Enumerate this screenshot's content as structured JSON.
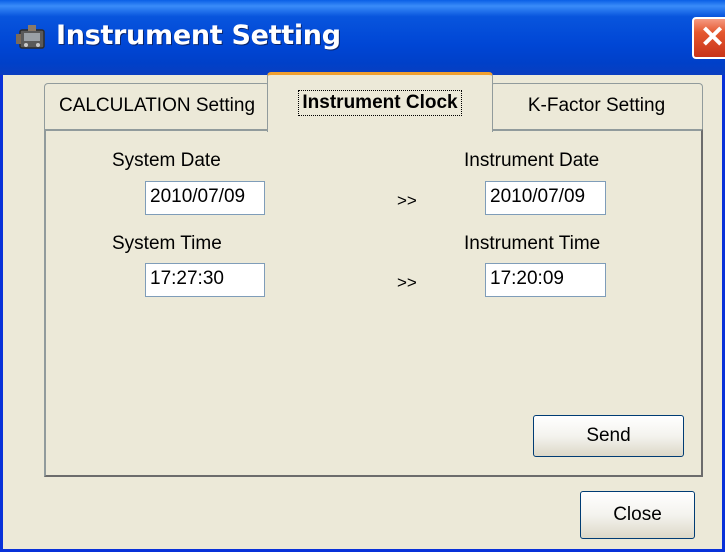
{
  "window": {
    "title": "Instrument Setting",
    "close_glyph": "✕"
  },
  "tabs": [
    {
      "label": "CALCULATION Setting",
      "active": false
    },
    {
      "label": "Instrument Clock",
      "active": true
    },
    {
      "label": "K-Factor Setting",
      "active": false
    }
  ],
  "clock": {
    "system_date_label": "System Date",
    "system_date_value": "2010/07/09",
    "instrument_date_label": "Instrument Date",
    "instrument_date_value": "2010/07/09",
    "system_time_label": "System Time",
    "system_time_value": "17:27:30",
    "instrument_time_label": "Instrument Time",
    "instrument_time_value": "17:20:09",
    "date_arrow": ">>",
    "time_arrow": ">>",
    "send_label": "Send"
  },
  "footer": {
    "close_label": "Close"
  },
  "colors": {
    "titlebar": "#0046d5",
    "window_bg": "#ece9d8",
    "close_button": "#e5582f",
    "active_tab_accent": "#f0a030"
  },
  "icons": {
    "app_icon": "instrument-icon",
    "close_icon": "close-icon"
  }
}
